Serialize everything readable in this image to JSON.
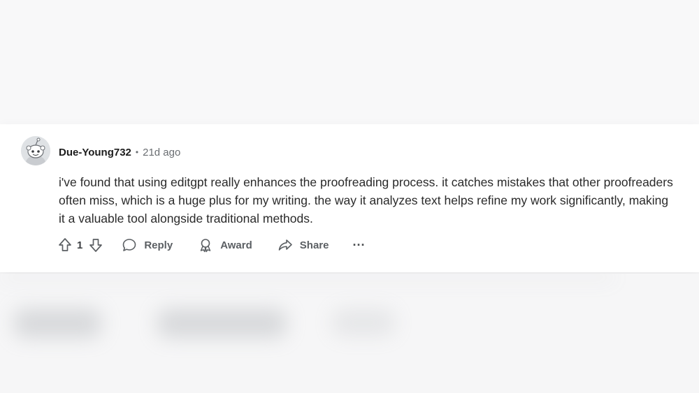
{
  "comment": {
    "author": "Due-Young732",
    "separator": "•",
    "time": "21d ago",
    "body": "i've found that using editgpt really enhances the proofreading process. it catches mistakes that other proofreaders often miss, which is a huge plus for my writing. the way it analyzes text helps refine my work significantly, making it a valuable tool alongside traditional methods."
  },
  "actions": {
    "vote_count": "1",
    "reply_label": "Reply",
    "award_label": "Award",
    "share_label": "Share",
    "more_label": "···"
  },
  "icons": {
    "upvote": "arrow-up-icon",
    "downvote": "arrow-down-icon",
    "reply": "speech-bubble-icon",
    "award": "award-ribbon-icon",
    "share": "share-arrow-icon",
    "more": "ellipsis-icon",
    "avatar": "snoo-avatar-icon"
  },
  "colors": {
    "text_primary": "#1c1c1c",
    "text_secondary": "#5b5f63",
    "card_background": "#ffffff",
    "page_background": "#f5f5f6"
  }
}
